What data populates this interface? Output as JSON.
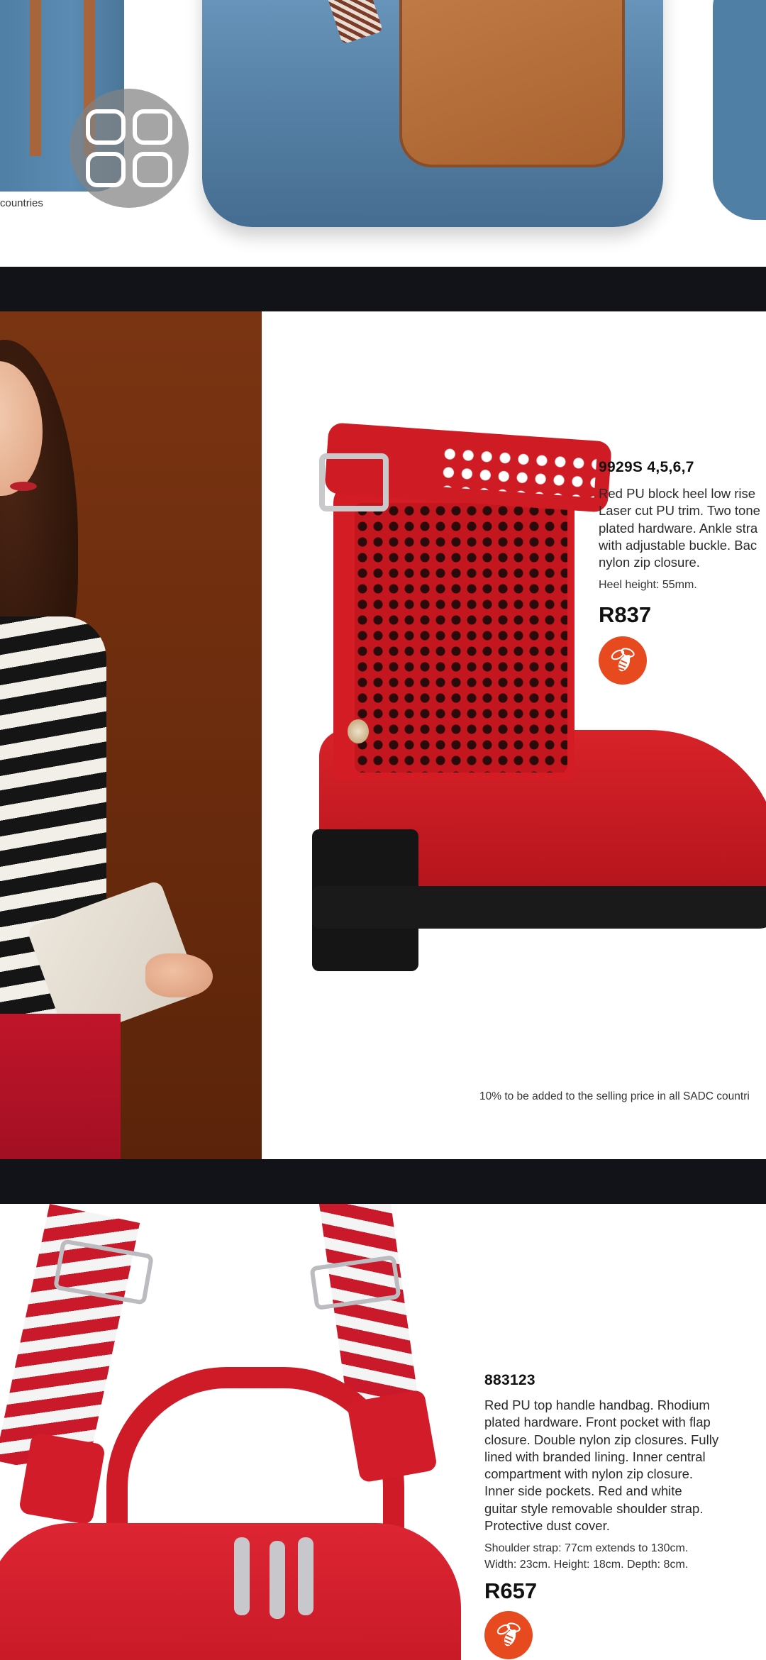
{
  "page1": {
    "footnote": "countries",
    "menu_icon": "grid-menu-icon"
  },
  "product_boot": {
    "code": "9929S 4,5,6,7",
    "description_lines": [
      "Red PU block heel low rise",
      "Laser cut PU trim. Two tone",
      "plated hardware. Ankle stra",
      "with adjustable buckle. Bac",
      "nylon zip closure."
    ],
    "heel": "Heel height: 55mm.",
    "price": "R837",
    "badge_icon": "bee-icon",
    "footnote": "10% to be added to the selling price in all SADC countri"
  },
  "product_handbag": {
    "code": "883123",
    "description_lines": [
      "Red PU top handle handbag. Rhodium",
      "plated hardware. Front pocket with flap",
      "closure. Double nylon zip closures. Fully",
      "lined with branded lining. Inner central",
      "compartment with nylon zip closure.",
      "Inner side pockets. Red and white",
      "guitar style removable shoulder strap.",
      "Protective dust cover."
    ],
    "dimension_lines": [
      "Shoulder strap: 77cm extends to 130cm.",
      "Width: 23cm. Height: 18cm. Depth: 8cm."
    ],
    "price": "R657",
    "badge_icon": "bee-icon"
  },
  "colors": {
    "page_gap": "#111318",
    "badge": "#e84a1f",
    "product_red": "#d31c24"
  }
}
